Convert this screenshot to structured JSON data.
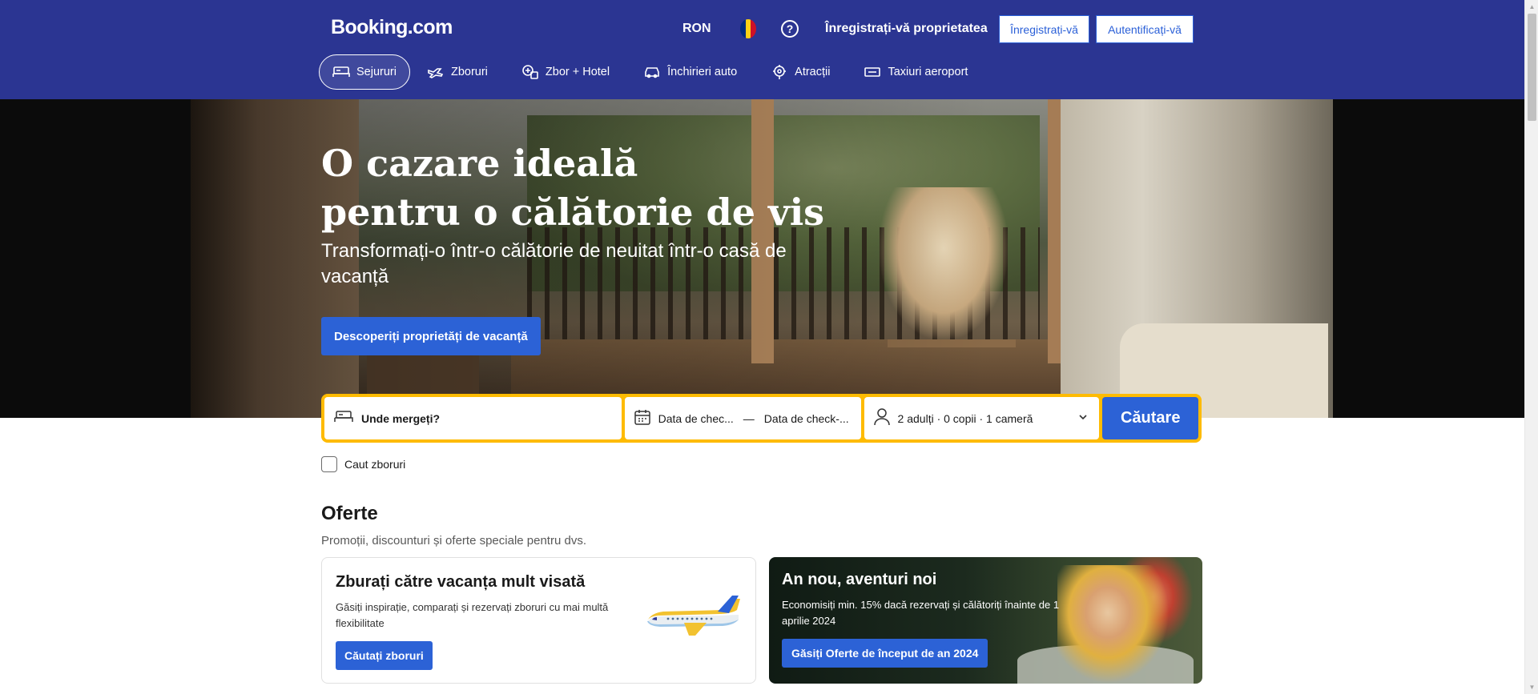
{
  "header": {
    "logo": "Booking.com",
    "currency": "RON",
    "flag_colors": [
      "#002b7f",
      "#fcd116",
      "#ce1126"
    ],
    "help_icon_label": "?",
    "list_property": "Înregistrați-vă proprietatea",
    "register": "Înregistrați-vă",
    "sign_in": "Autentificați-vă"
  },
  "nav": {
    "items": [
      {
        "label": "Sejururi",
        "icon": "bed-icon",
        "active": true
      },
      {
        "label": "Zboruri",
        "icon": "plane-icon"
      },
      {
        "label": "Zbor + Hotel",
        "icon": "flight-hotel-icon"
      },
      {
        "label": "Închirieri auto",
        "icon": "car-icon"
      },
      {
        "label": "Atracții",
        "icon": "attractions-icon"
      },
      {
        "label": "Taxiuri aeroport",
        "icon": "taxi-icon"
      }
    ]
  },
  "hero": {
    "title": "O cazare ideală\npentru o călătorie de vis",
    "subtitle": "Transformați-o într-o călătorie de neuitat într-o casă de vacanță",
    "cta": "Descoperiți proprietăți de vacanță"
  },
  "search": {
    "destination_placeholder": "Unde mergeți?",
    "checkin": "Data de chec...",
    "separator": "—",
    "checkout": "Data de check-...",
    "occupancy": "2 adulți · 0 copii · 1 cameră",
    "button": "Căutare",
    "border_color": "#febb02"
  },
  "flights_checkbox": {
    "label": "Caut zboruri",
    "checked": false
  },
  "offers": {
    "title": "Oferte",
    "subtitle": "Promoții, discounturi și oferte speciale pentru dvs.",
    "cards": [
      {
        "title": "Zburați către vacanța mult visată",
        "description": "Găsiți inspirație, comparați și rezervați zboruri cu mai multă flexibilitate",
        "button": "Căutați zboruri"
      },
      {
        "title": "An nou, aventuri noi",
        "description": "Economisiți min. 15% dacă rezervați și călătoriți înainte de 1 aprilie 2024",
        "button": "Găsiți Oferte de început de an 2024"
      }
    ]
  },
  "colors": {
    "brand_blue": "#2b3592",
    "action_blue": "#2c62d6",
    "yellow": "#febb02"
  }
}
